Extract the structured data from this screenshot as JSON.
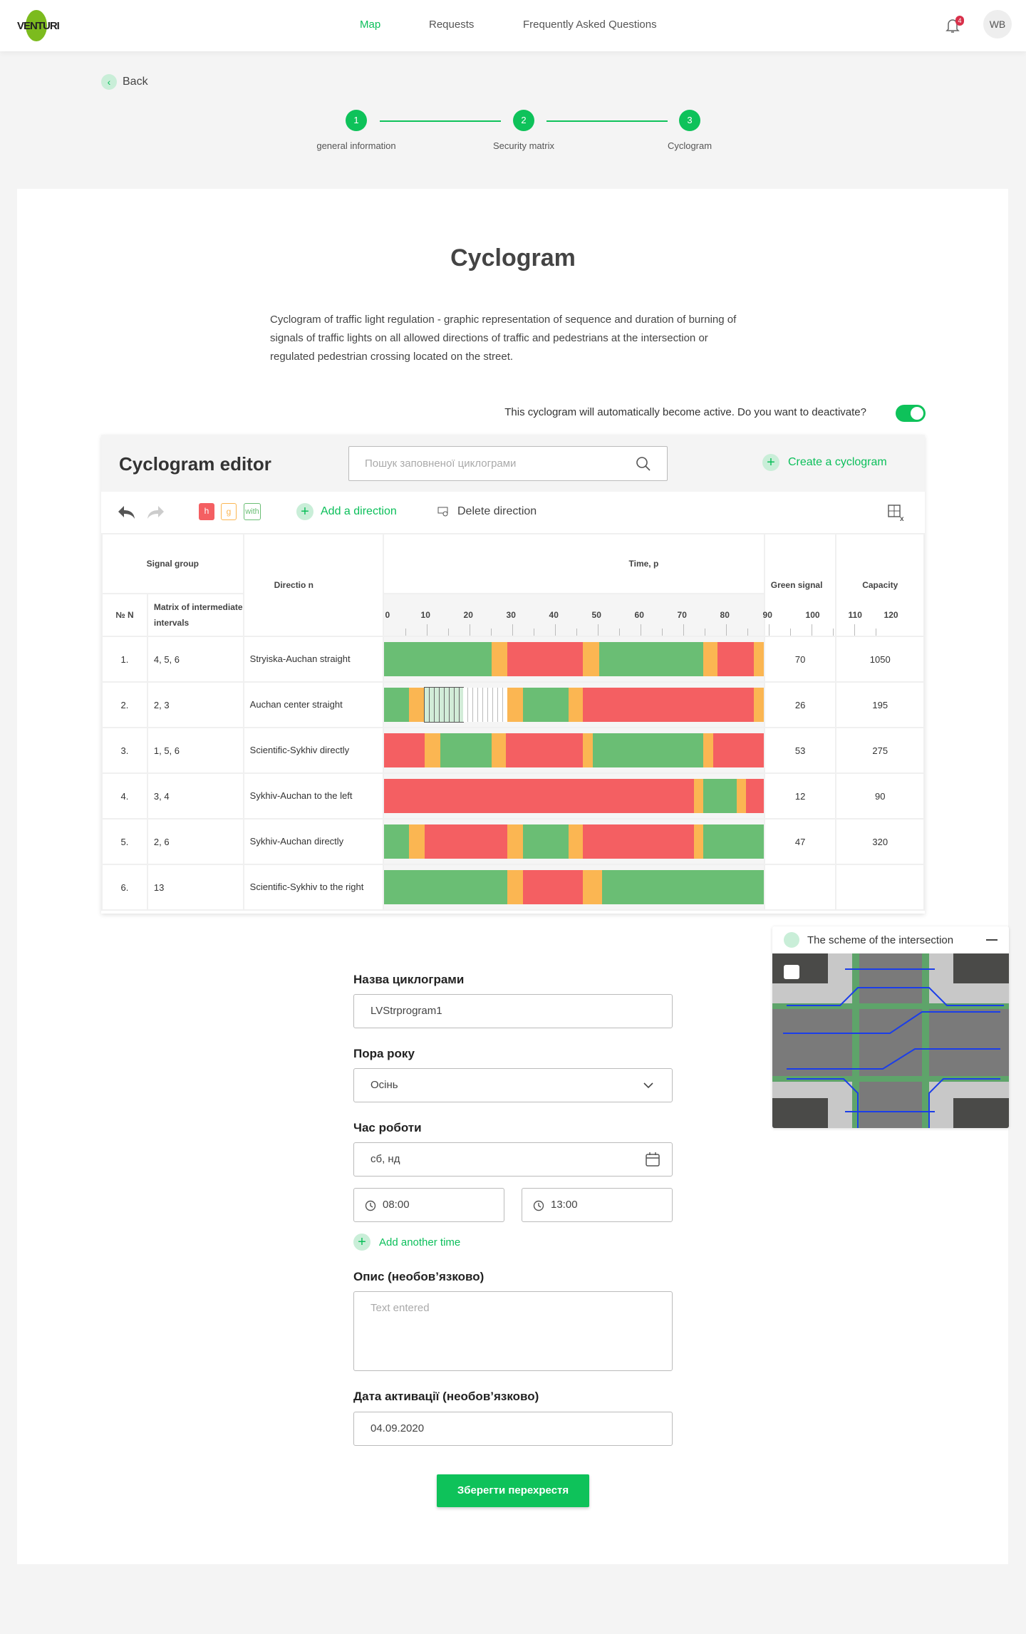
{
  "header": {
    "logo": "VENTURI",
    "nav": [
      {
        "label": "Map",
        "active": true
      },
      {
        "label": "Requests"
      },
      {
        "label": "Frequently Asked Questions"
      }
    ],
    "notifications": "4",
    "avatar": "WB"
  },
  "back_label": "Back",
  "stepper": [
    {
      "num": "1",
      "label": "general information"
    },
    {
      "num": "2",
      "label": "Security matrix"
    },
    {
      "num": "3",
      "label": "Cyclogram"
    }
  ],
  "page": {
    "title": "Cyclogram",
    "description": "Cyclogram of traffic light regulation - graphic representation of sequence and duration of burning of signals of traffic lights on all allowed directions of traffic and pedestrians at the intersection or regulated pedestrian crossing located on the street.",
    "toggle_text": "This cyclogram will automatically become active. Do you want to deactivate?",
    "toggle_on": true
  },
  "editor": {
    "title": "Cyclogram editor",
    "search_placeholder": "Пошук заповненої циклограми",
    "create_label": "Create a cyclogram",
    "toolbar": {
      "chip_red": "h",
      "chip_yellow": "g",
      "chip_green": "with",
      "add_direction": "Add a direction",
      "delete_direction": "Delete direction"
    },
    "headers": {
      "signal_group": "Signal group",
      "no": "№ N",
      "matrix": "Matrix of intermediate intervals",
      "direction": "Directio n",
      "time": "Time, p",
      "green": "Green signal",
      "capacity": "Capacity"
    },
    "ticks": [
      "0",
      "10",
      "20",
      "30",
      "40",
      "50",
      "60",
      "70",
      "80",
      "90",
      "100",
      "110",
      "120"
    ]
  },
  "colors": {
    "green": "#6abe74",
    "yellow": "#fbb652",
    "red": "#f45f62",
    "accent": "#0ec25a"
  },
  "chart_data": {
    "type": "table",
    "cycle_length": 120,
    "rows": [
      {
        "no": "1.",
        "matrix": "4, 5, 6",
        "direction": "Stryiska-Auchan straight",
        "green": "70",
        "capacity": "1050",
        "segments": [
          [
            "green",
            0,
            34
          ],
          [
            "yellow",
            34,
            39
          ],
          [
            "red",
            39,
            63
          ],
          [
            "yellow",
            63,
            68
          ],
          [
            "green",
            68,
            101
          ],
          [
            "yellow",
            101,
            105.5
          ],
          [
            "red",
            105.5,
            117
          ],
          [
            "yellow",
            117,
            120
          ]
        ]
      },
      {
        "no": "2.",
        "matrix": "2, 3",
        "direction": "Auchan center straight",
        "green": "26",
        "capacity": "195",
        "segments": [
          [
            "green",
            0,
            8
          ],
          [
            "yellow",
            8,
            13
          ],
          [
            "hatch-green",
            13,
            25
          ],
          [
            "hatch",
            25,
            39
          ],
          [
            "yellow",
            39,
            44
          ],
          [
            "green",
            44,
            58.5
          ],
          [
            "yellow",
            58.5,
            63
          ],
          [
            "red",
            63,
            117
          ],
          [
            "yellow",
            117,
            120
          ]
        ]
      },
      {
        "no": "3.",
        "matrix": "1, 5, 6",
        "direction": "Scientific-Sykhiv directly",
        "green": "53",
        "capacity": "275",
        "segments": [
          [
            "red",
            0,
            13
          ],
          [
            "yellow",
            13,
            18
          ],
          [
            "green",
            18,
            34
          ],
          [
            "yellow",
            34,
            38.5
          ],
          [
            "red",
            38.5,
            63
          ],
          [
            "yellow",
            63,
            66
          ],
          [
            "green",
            66,
            101
          ],
          [
            "yellow",
            101,
            104
          ],
          [
            "red",
            104,
            120
          ]
        ]
      },
      {
        "no": "4.",
        "matrix": "3, 4",
        "direction": "Sykhiv-Auchan to the left",
        "green": "12",
        "capacity": "90",
        "segments": [
          [
            "red",
            0,
            98
          ],
          [
            "yellow",
            98,
            101
          ],
          [
            "green",
            101,
            111.5
          ],
          [
            "yellow",
            111.5,
            114.5
          ],
          [
            "red",
            114.5,
            120
          ]
        ]
      },
      {
        "no": "5.",
        "matrix": "2, 6",
        "direction": "Sykhiv-Auchan directly",
        "green": "47",
        "capacity": "320",
        "segments": [
          [
            "green",
            0,
            8
          ],
          [
            "yellow",
            8,
            13
          ],
          [
            "red",
            13,
            39
          ],
          [
            "yellow",
            39,
            44
          ],
          [
            "green",
            44,
            58.5
          ],
          [
            "yellow",
            58.5,
            63
          ],
          [
            "red",
            63,
            98
          ],
          [
            "yellow",
            98,
            101
          ],
          [
            "green",
            101,
            120
          ]
        ]
      },
      {
        "no": "6.",
        "matrix": "13",
        "direction": "Scientific-Sykhiv to the right",
        "green": "",
        "capacity": "",
        "segments": [
          [
            "green",
            0,
            39
          ],
          [
            "yellow",
            39,
            44
          ],
          [
            "red",
            44,
            63
          ],
          [
            "yellow",
            63,
            69
          ],
          [
            "green",
            69,
            120
          ]
        ]
      }
    ]
  },
  "form": {
    "name_label": "Назва циклограми",
    "name_value": "LVStrprogram1",
    "season_label": "Пора року",
    "season_value": "Осінь",
    "time_label": "Час роботи",
    "days_value": "сб, нд",
    "time_from": "08:00",
    "time_to": "13:00",
    "add_time": "Add another time",
    "desc_label": "Опис (необов’язково)",
    "desc_placeholder": "Text entered",
    "date_label": "Дата активації (необов’язково)",
    "date_value": "04.09.2020",
    "save": "Зберегти перехрестя"
  },
  "scheme": {
    "title": "The scheme of the intersection"
  }
}
